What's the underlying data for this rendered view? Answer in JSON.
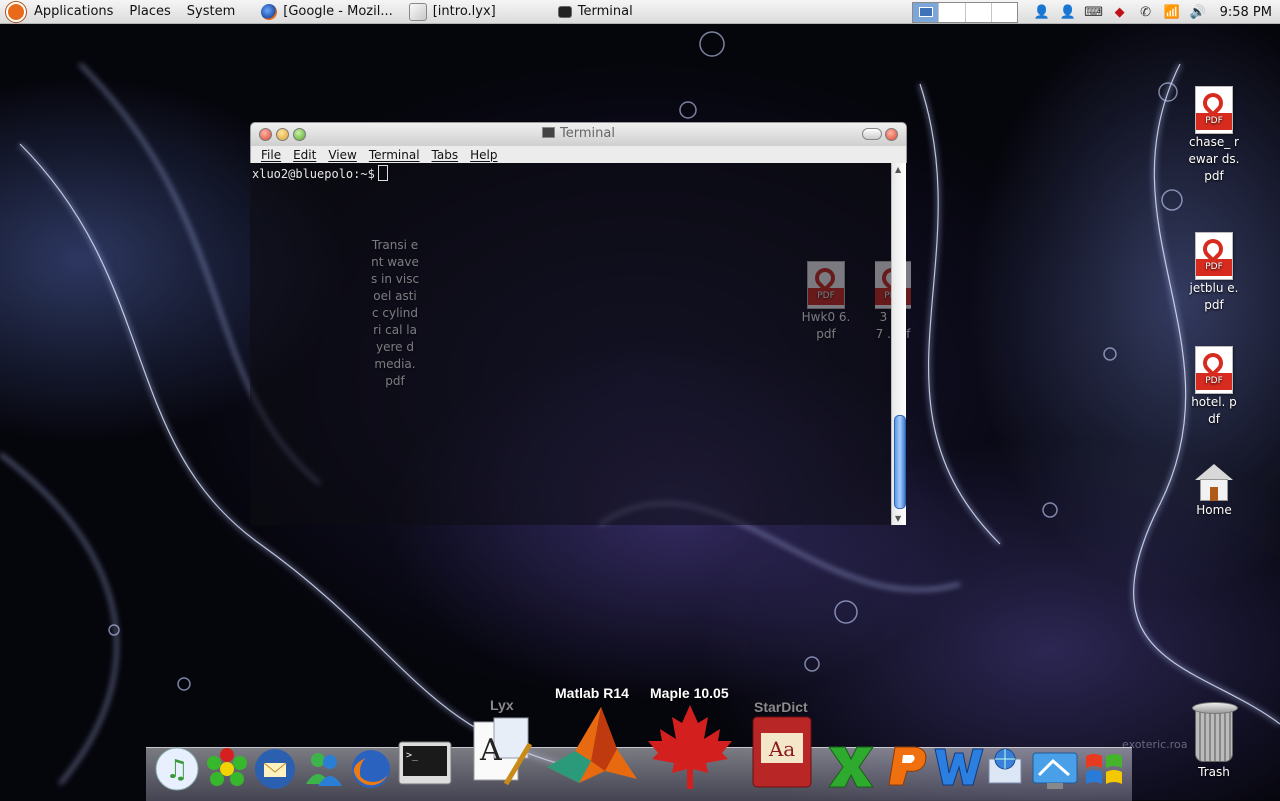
{
  "top_panel": {
    "menus": [
      "Applications",
      "Places",
      "System"
    ],
    "tasks": [
      {
        "label": "[Google - Mozil...",
        "icon": "firefox-icon"
      },
      {
        "label": "[intro.lyx]",
        "icon": "lyx-icon"
      },
      {
        "label": "Terminal",
        "icon": "terminal-icon"
      }
    ],
    "clock": "9:58 PM"
  },
  "terminal": {
    "title": "Terminal",
    "menus": [
      "File",
      "Edit",
      "View",
      "Terminal",
      "Tabs",
      "Help"
    ],
    "prompt": "xluo2@bluepolo:~$"
  },
  "desktop_icons": {
    "chase": "chase_ rewar ds.pdf",
    "jetblue": "jetblu e.pdf",
    "hotel": "hotel. pdf",
    "home": "Home",
    "trash": "Trash",
    "behind_transient": "Transi ent waves in viscoel astic cylindri cal layere d media. pdf",
    "behind_hwk": "Hwk0 6.pdf",
    "behind_num": "3 39 7 .pdf"
  },
  "dock": {
    "labels": {
      "lyx": "Lyx",
      "matlab": "Matlab R14",
      "maple": "Maple 10.05",
      "stardict": "StarDict"
    }
  },
  "colors": {
    "panel": "#dcdcdc",
    "thumb": "#5b9ae8",
    "pdf_red": "#d62b1e",
    "maple_red": "#d41f1f"
  }
}
